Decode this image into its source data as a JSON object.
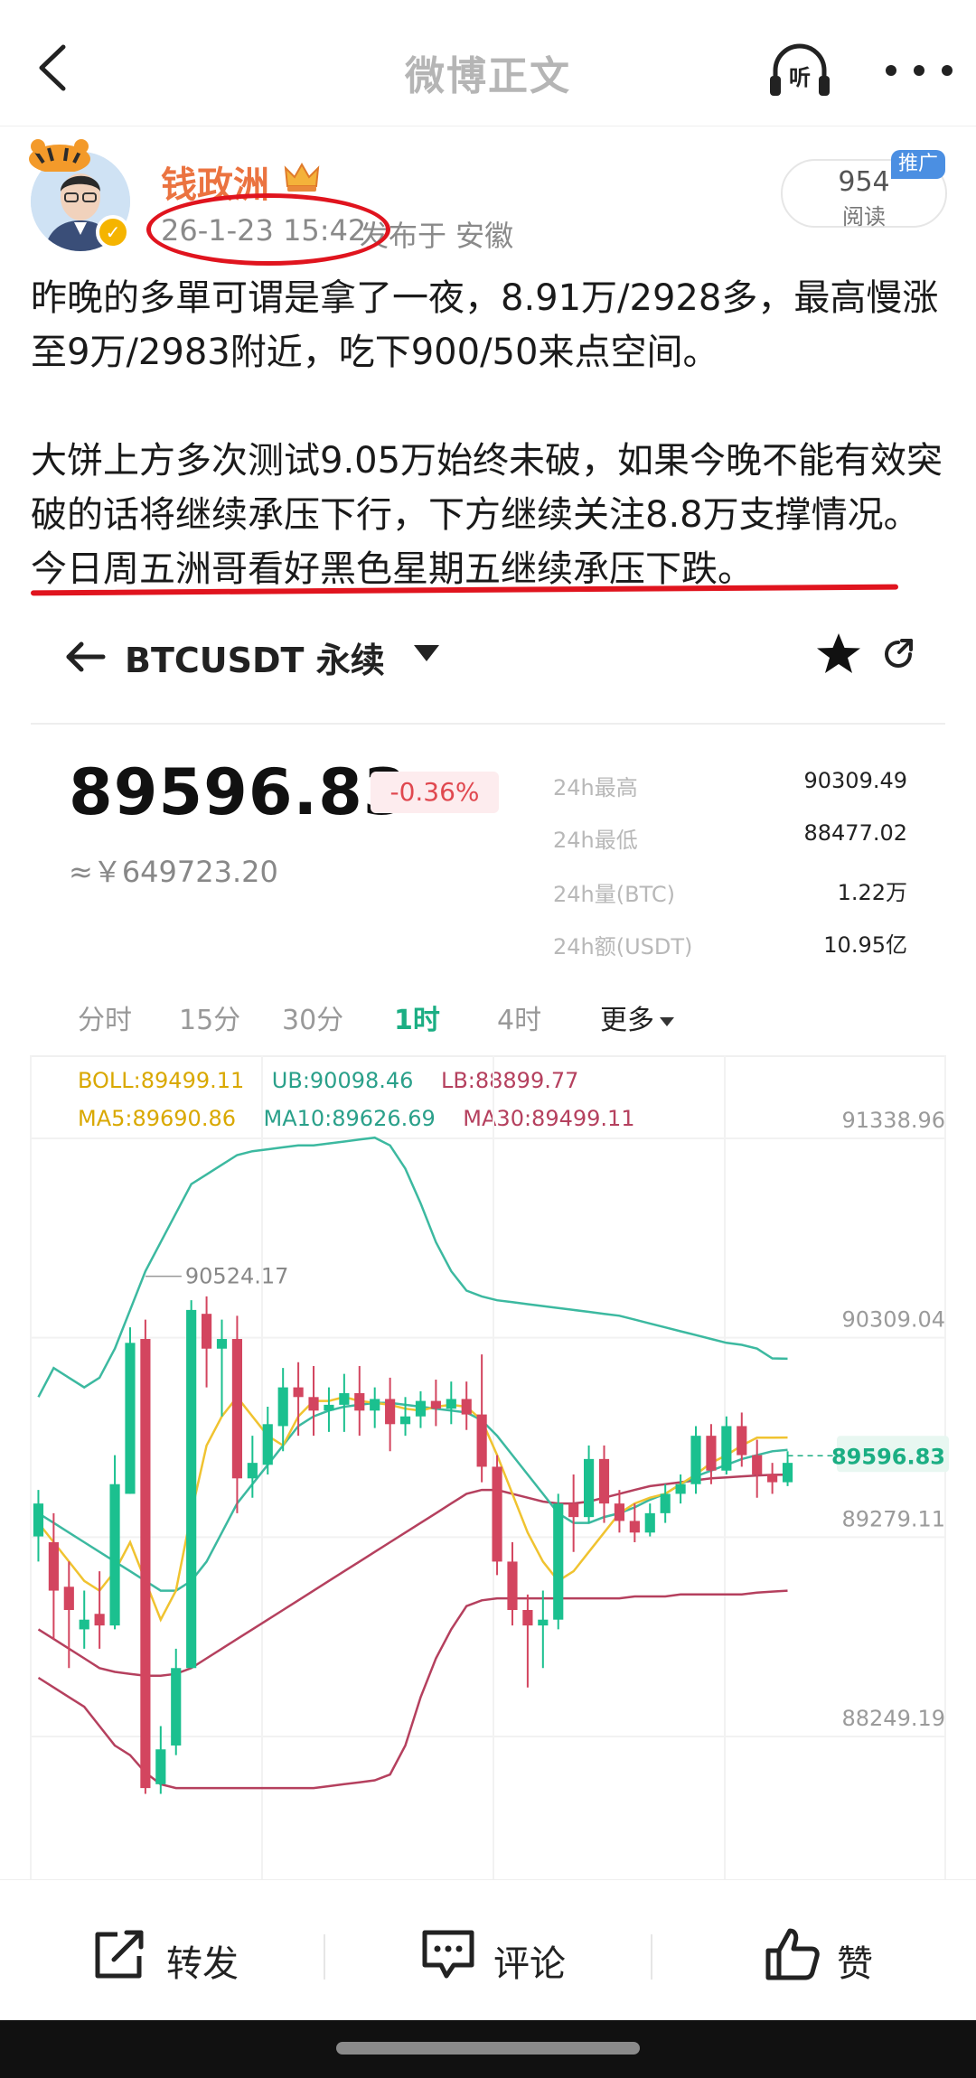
{
  "nav": {
    "title": "微博正文",
    "listen_label": "听"
  },
  "author": {
    "name": "钱政洲",
    "time": "26-1-23 15:42",
    "location": "发布于 安徽",
    "read_count": "954",
    "read_label": "阅读",
    "promo_tag": "推广"
  },
  "post": {
    "paragraphs": [
      "昨晚的多單可谓是拿了一夜，8.91万/2928多，最高慢涨至9万/2983附近，吃下900/50来点空间。",
      "",
      "大饼上方多次测试9.05万始终未破，如果今晚不能有效突破的话将继续承压下行，下方继续关注8.8万支撑情况。今日周五洲哥看好黑色星期五继续承压下跌。"
    ]
  },
  "ticker": {
    "symbol": "BTCUSDT 永续",
    "price": "89596.83",
    "change": "-0.36%",
    "cny": "≈￥649723.20",
    "stats": [
      {
        "label": "24h最高",
        "value": "90309.49"
      },
      {
        "label": "24h最低",
        "value": "88477.02"
      },
      {
        "label": "24h量(BTC)",
        "value": "1.22万"
      },
      {
        "label": "24h额(USDT)",
        "value": "10.95亿"
      }
    ],
    "timeframes": [
      "分时",
      "15分",
      "30分",
      "1时",
      "4时",
      "更多"
    ],
    "active_timeframe": "1时"
  },
  "indicators": {
    "boll": "BOLL:89499.11",
    "ub": "UB:90098.46",
    "lb": "LB:88899.77",
    "ma5": "MA5:89690.86",
    "ma10": "MA10:89626.69",
    "ma30": "MA30:89499.11"
  },
  "colors": {
    "up": "#1bc08f",
    "down": "#d3455f",
    "boll_upper": "#3cb9a0",
    "boll_lower": "#b5405e",
    "ma5": "#f0c330",
    "ma10": "#3cb9a0",
    "ma30": "#b5405e",
    "accent": "#1bae83",
    "annotation": "#e0141e"
  },
  "chart_data": {
    "type": "candlestick",
    "y_ticks": [
      "91338.96",
      "90309.04",
      "89279.11",
      "88249.19"
    ],
    "y_tick_values": [
      91338.96,
      90309.04,
      89279.11,
      88249.19
    ],
    "max_label": "90524.17",
    "last_price_label": "89596.83",
    "ylim": [
      87800,
      91500
    ],
    "candles": [
      {
        "o": 89180,
        "h": 89420,
        "c": 89350,
        "l": 89050
      },
      {
        "o": 89150,
        "h": 89300,
        "c": 88900,
        "l": 88650
      },
      {
        "o": 88920,
        "h": 89050,
        "c": 88800,
        "l": 88500
      },
      {
        "o": 88700,
        "h": 88900,
        "c": 88750,
        "l": 88600
      },
      {
        "o": 88780,
        "h": 89000,
        "c": 88720,
        "l": 88600
      },
      {
        "o": 88720,
        "h": 89600,
        "c": 89450,
        "l": 88700
      },
      {
        "o": 89400,
        "h": 90260,
        "c": 90180,
        "l": 89400
      },
      {
        "o": 90200,
        "h": 90300,
        "c": 87880,
        "l": 87850
      },
      {
        "o": 87900,
        "h": 88200,
        "c": 88080,
        "l": 87850
      },
      {
        "o": 88100,
        "h": 88600,
        "c": 88500,
        "l": 88050
      },
      {
        "o": 88500,
        "h": 90400,
        "c": 90350,
        "l": 88500
      },
      {
        "o": 90330,
        "h": 90420,
        "c": 90150,
        "l": 89950
      },
      {
        "o": 90150,
        "h": 90300,
        "c": 90200,
        "l": 89800
      },
      {
        "o": 90200,
        "h": 90320,
        "c": 89480,
        "l": 89300
      },
      {
        "o": 89480,
        "h": 89700,
        "c": 89560,
        "l": 89380
      },
      {
        "o": 89550,
        "h": 89850,
        "c": 89760,
        "l": 89500
      },
      {
        "o": 89750,
        "h": 90050,
        "c": 89950,
        "l": 89620
      },
      {
        "o": 89950,
        "h": 90080,
        "c": 89900,
        "l": 89700
      },
      {
        "o": 89900,
        "h": 90060,
        "c": 89830,
        "l": 89700
      },
      {
        "o": 89830,
        "h": 89950,
        "c": 89860,
        "l": 89720
      },
      {
        "o": 89860,
        "h": 90020,
        "c": 89920,
        "l": 89720
      },
      {
        "o": 89920,
        "h": 90060,
        "c": 89830,
        "l": 89700
      },
      {
        "o": 89830,
        "h": 89950,
        "c": 89890,
        "l": 89740
      },
      {
        "o": 89890,
        "h": 90000,
        "c": 89760,
        "l": 89620
      },
      {
        "o": 89760,
        "h": 89900,
        "c": 89800,
        "l": 89700
      },
      {
        "o": 89800,
        "h": 89930,
        "c": 89880,
        "l": 89740
      },
      {
        "o": 89880,
        "h": 89990,
        "c": 89840,
        "l": 89750
      },
      {
        "o": 89840,
        "h": 89980,
        "c": 89890,
        "l": 89760
      },
      {
        "o": 89890,
        "h": 89980,
        "c": 89810,
        "l": 89730
      },
      {
        "o": 89810,
        "h": 90120,
        "c": 89540,
        "l": 89460
      },
      {
        "o": 89540,
        "h": 89600,
        "c": 89050,
        "l": 88980
      },
      {
        "o": 89050,
        "h": 89150,
        "c": 88800,
        "l": 88720
      },
      {
        "o": 88800,
        "h": 88880,
        "c": 88720,
        "l": 88400
      },
      {
        "o": 88720,
        "h": 88900,
        "c": 88750,
        "l": 88500
      },
      {
        "o": 88750,
        "h": 89400,
        "c": 89350,
        "l": 88700
      },
      {
        "o": 89350,
        "h": 89500,
        "c": 89280,
        "l": 89100
      },
      {
        "o": 89280,
        "h": 89650,
        "c": 89580,
        "l": 89250
      },
      {
        "o": 89580,
        "h": 89650,
        "c": 89350,
        "l": 89250
      },
      {
        "o": 89350,
        "h": 89420,
        "c": 89260,
        "l": 89200
      },
      {
        "o": 89260,
        "h": 89350,
        "c": 89200,
        "l": 89150
      },
      {
        "o": 89200,
        "h": 89350,
        "c": 89300,
        "l": 89180
      },
      {
        "o": 89300,
        "h": 89450,
        "c": 89400,
        "l": 89250
      },
      {
        "o": 89400,
        "h": 89500,
        "c": 89450,
        "l": 89350
      },
      {
        "o": 89450,
        "h": 89750,
        "c": 89700,
        "l": 89400
      },
      {
        "o": 89700,
        "h": 89760,
        "c": 89520,
        "l": 89450
      },
      {
        "o": 89520,
        "h": 89800,
        "c": 89750,
        "l": 89500
      },
      {
        "o": 89750,
        "h": 89820,
        "c": 89600,
        "l": 89540
      },
      {
        "o": 89600,
        "h": 89680,
        "c": 89500,
        "l": 89380
      },
      {
        "o": 89500,
        "h": 89560,
        "c": 89460,
        "l": 89400
      },
      {
        "o": 89460,
        "h": 89620,
        "c": 89560,
        "l": 89440
      }
    ],
    "ub": [
      89900,
      90050,
      90000,
      89950,
      90000,
      90150,
      90350,
      90550,
      90700,
      90850,
      91000,
      91050,
      91100,
      91150,
      91170,
      91180,
      91190,
      91200,
      91200,
      91210,
      91220,
      91230,
      91240,
      91200,
      91080,
      90900,
      90700,
      90550,
      90450,
      90420,
      90400,
      90390,
      90380,
      90370,
      90360,
      90350,
      90340,
      90330,
      90320,
      90300,
      90280,
      90260,
      90240,
      90220,
      90200,
      90180,
      90170,
      90150,
      90100,
      90098
    ],
    "lb": [
      88450,
      88400,
      88350,
      88300,
      88200,
      88100,
      88050,
      87960,
      87900,
      87880,
      87880,
      87880,
      87880,
      87880,
      87880,
      87880,
      87880,
      87880,
      87880,
      87890,
      87900,
      87910,
      87920,
      87950,
      88100,
      88350,
      88550,
      88700,
      88820,
      88850,
      88860,
      88860,
      88860,
      88860,
      88860,
      88860,
      88860,
      88860,
      88860,
      88870,
      88870,
      88870,
      88880,
      88880,
      88880,
      88880,
      88880,
      88890,
      88895,
      88900
    ],
    "ma5": [
      89250,
      89150,
      89050,
      88950,
      88900,
      89000,
      89150,
      88950,
      88750,
      88900,
      89300,
      89650,
      89800,
      89900,
      89800,
      89700,
      89650,
      89800,
      89880,
      89880,
      89900,
      89880,
      89870,
      89860,
      89840,
      89830,
      89850,
      89860,
      89850,
      89780,
      89600,
      89400,
      89200,
      89050,
      88950,
      89000,
      89100,
      89200,
      89300,
      89350,
      89380,
      89400,
      89450,
      89500,
      89560,
      89600,
      89650,
      89690,
      89690,
      89691
    ],
    "ma10": [
      89300,
      89250,
      89200,
      89150,
      89100,
      89050,
      89000,
      88950,
      88900,
      88900,
      88950,
      89050,
      89200,
      89350,
      89450,
      89550,
      89650,
      89750,
      89800,
      89830,
      89850,
      89860,
      89870,
      89870,
      89860,
      89850,
      89840,
      89830,
      89820,
      89780,
      89700,
      89600,
      89500,
      89400,
      89300,
      89250,
      89250,
      89280,
      89300,
      89330,
      89370,
      89400,
      89450,
      89490,
      89520,
      89550,
      89580,
      89600,
      89620,
      89627
    ],
    "ma30": [
      88700,
      88650,
      88600,
      88550,
      88500,
      88480,
      88470,
      88460,
      88460,
      88470,
      88500,
      88550,
      88600,
      88650,
      88700,
      88750,
      88800,
      88850,
      88900,
      88950,
      89000,
      89050,
      89100,
      89150,
      89200,
      89250,
      89300,
      89350,
      89400,
      89420,
      89420,
      89400,
      89380,
      89360,
      89350,
      89350,
      89360,
      89380,
      89400,
      89420,
      89440,
      89450,
      89460,
      89470,
      89480,
      89485,
      89490,
      89495,
      89498,
      89499
    ]
  },
  "actions": {
    "repost": "转发",
    "comment": "评论",
    "like": "赞"
  }
}
